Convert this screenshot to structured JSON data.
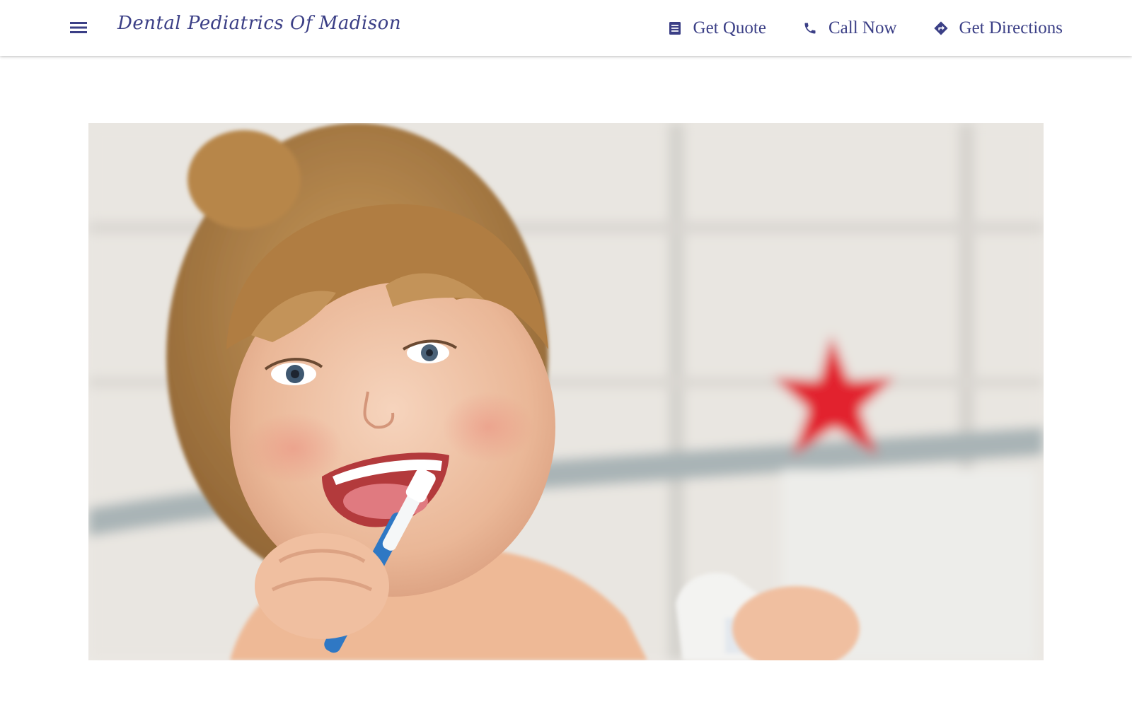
{
  "header": {
    "brand": "Dental Pediatrics Of Madison",
    "menu_icon": "hamburger-menu-icon",
    "actions": [
      {
        "label": "Get Quote",
        "icon": "quote-document-icon"
      },
      {
        "label": "Call Now",
        "icon": "phone-icon"
      },
      {
        "label": "Get Directions",
        "icon": "directions-icon"
      }
    ]
  },
  "hero": {
    "image_subject": "child-brushing-teeth-photo"
  },
  "colors": {
    "brand": "#3b3f86",
    "background": "#ffffff"
  }
}
